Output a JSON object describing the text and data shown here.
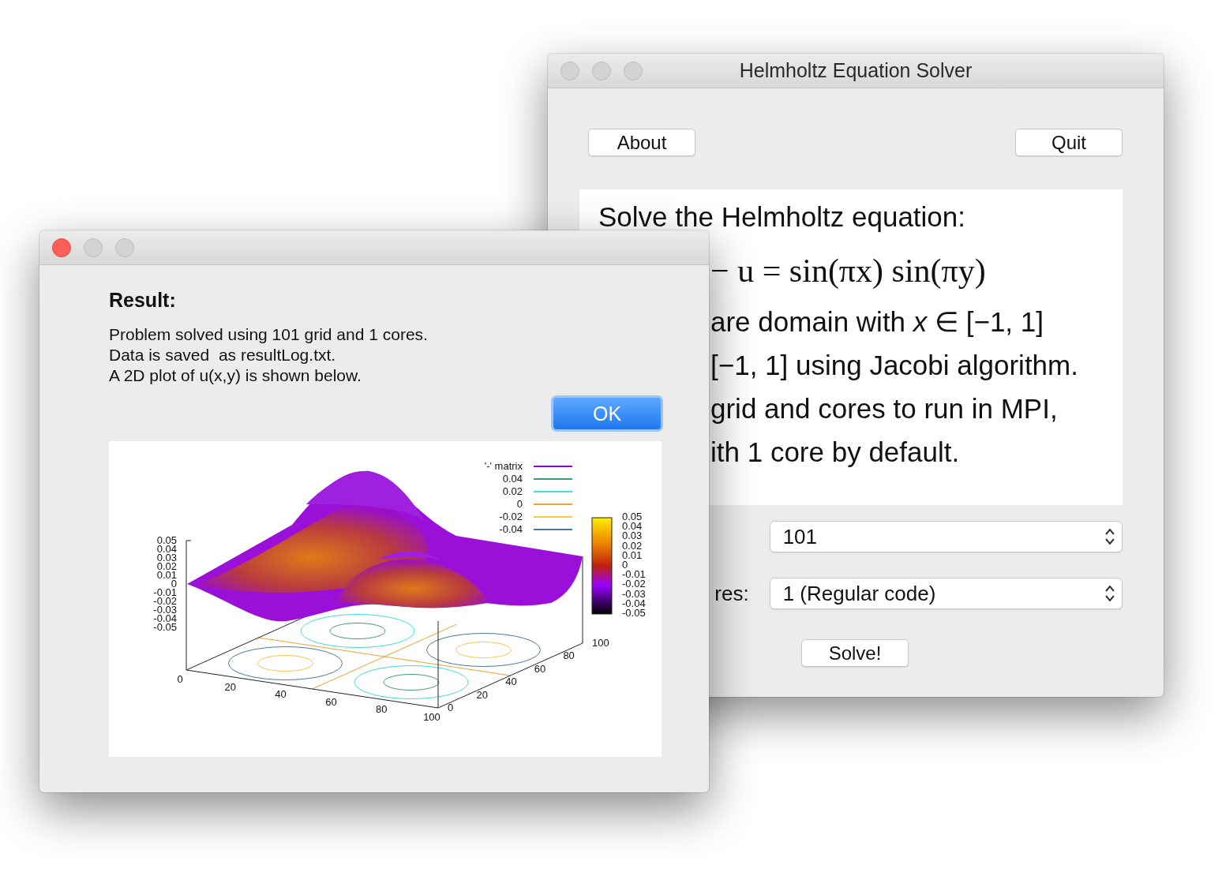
{
  "solver_window": {
    "title": "Helmholtz Equation Solver",
    "active": false,
    "buttons": [
      "About",
      "Quit"
    ],
    "description": [
      {
        "kind": "heading",
        "text": "Solve the Helmholtz equation:"
      },
      {
        "kind": "math",
        "text": "− u = sin(πx) sin(πy)"
      },
      {
        "kind": "cut",
        "text": "are domain with *x* ∈ [−1, 1]"
      },
      {
        "kind": "cut",
        "text": "[−1, 1] using Jacobi algorithm."
      },
      {
        "kind": "cut",
        "text": "grid and cores to run in MPI,"
      },
      {
        "kind": "cut",
        "text": "ith 1 core by default."
      }
    ],
    "fields": [
      {
        "value": "101"
      },
      {
        "label": "res:",
        "value": "1 (Regular code)"
      }
    ],
    "solve_button": "Solve!"
  },
  "result_dialog": {
    "active": true,
    "heading": "Result:",
    "message": [
      "Problem solved using 101 grid and 1 cores.",
      "Data is saved  as resultLog.txt.",
      "A 2D plot of u(x,y) is shown below."
    ],
    "ok_button": "OK",
    "plot": {
      "legend": [
        {
          "label": "'-' matrix",
          "color": "#9400d3"
        },
        {
          "label": "0.04",
          "color": "#3f9b72"
        },
        {
          "label": "0.02",
          "color": "#40e0d0"
        },
        {
          "label": "0",
          "color": "#f0a030"
        },
        {
          "label": "-0.02",
          "color": "#f5c84a"
        },
        {
          "label": "-0.04",
          "color": "#4a78a0"
        }
      ],
      "colorbar_ticks": [
        "0.05",
        "0.04",
        "0.03",
        "0.02",
        "0.01",
        "0",
        "-0.01",
        "-0.02",
        "-0.03",
        "-0.04",
        "-0.05"
      ],
      "z_ticks": [
        "0.05",
        "0.04",
        "0.03",
        "0.02",
        "0.01",
        "0",
        "-0.01",
        "-0.02",
        "-0.03",
        "-0.04",
        "-0.05"
      ],
      "x_ticks": [
        "0",
        "20",
        "40",
        "60",
        "80",
        "100"
      ],
      "y_ticks": [
        "0",
        "20",
        "40",
        "60",
        "80",
        "100"
      ]
    }
  }
}
